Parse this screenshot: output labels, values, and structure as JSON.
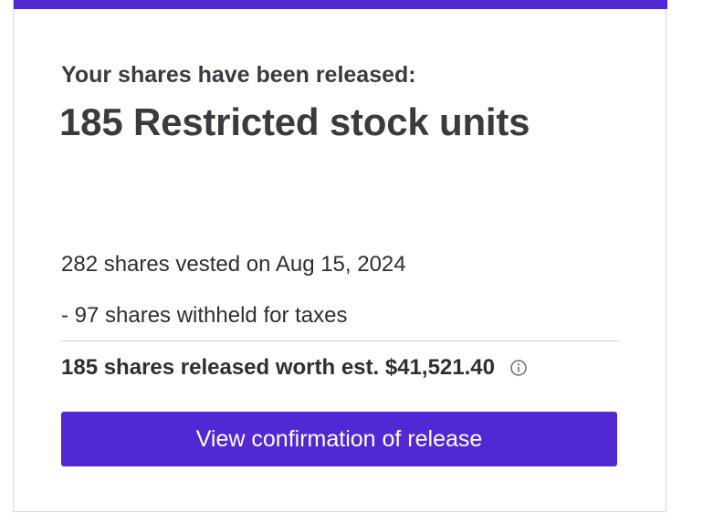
{
  "theme": {
    "accent_color": "#5128d4"
  },
  "release_card": {
    "eyebrow": "Your shares have been released:",
    "headline": "185 Restricted stock units",
    "vested_line": "282 shares vested on Aug 15, 2024",
    "withheld_line": "- 97 shares withheld for taxes",
    "total_line": "185 shares released worth est. $41,521.40",
    "info_icon": "info-circle-icon",
    "cta_label": "View confirmation of release"
  }
}
